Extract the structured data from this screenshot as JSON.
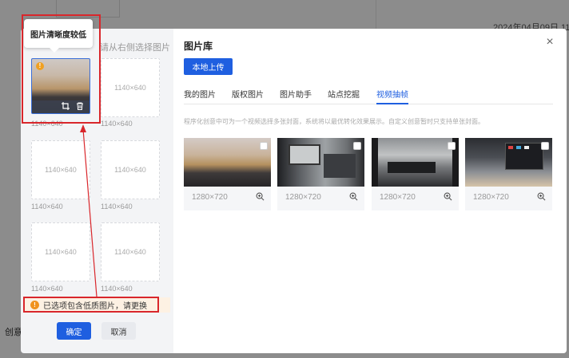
{
  "background": {
    "date_text": "2024年04月09日 11:3",
    "side_label": "创意"
  },
  "left_panel": {
    "hint": "请从右侧选择图片",
    "tooltip": "图片清晰度较低",
    "slot_size_label": "1140×640",
    "slots": [
      {
        "caption": "1140×640"
      },
      {
        "caption": "1140×640",
        "inner": "1140×640"
      },
      {
        "caption": "1140×640",
        "inner": "1140×640"
      },
      {
        "caption": "1140×640",
        "inner": "1140×640"
      },
      {
        "caption": "1140×640",
        "inner": "1140×640"
      },
      {
        "caption": "1140×640",
        "inner": "1140×640"
      }
    ],
    "warning_text": "已选项包含低质图片，请更换",
    "warning_icon": "!",
    "confirm_label": "确定",
    "cancel_label": "取消"
  },
  "library": {
    "title": "图片库",
    "close_icon": "×",
    "upload_label": "本地上传",
    "tabs": [
      {
        "label": "我的图片",
        "active": false
      },
      {
        "label": "版权图片",
        "active": false
      },
      {
        "label": "图片助手",
        "active": false
      },
      {
        "label": "站点挖掘",
        "active": false
      },
      {
        "label": "视频抽帧",
        "active": true
      }
    ],
    "description": "程序化创意中可为一个视频选择多张封面，系统将以最优转化效果展示。自定义创意暂时只支持单张封面。",
    "images": [
      {
        "size": "1280×720"
      },
      {
        "size": "1280×720"
      },
      {
        "size": "1280×720"
      },
      {
        "size": "1280×720"
      }
    ]
  },
  "colors": {
    "primary": "#1f5fe0",
    "annotation_red": "#d9262b",
    "warning_orange": "#f0921e"
  }
}
